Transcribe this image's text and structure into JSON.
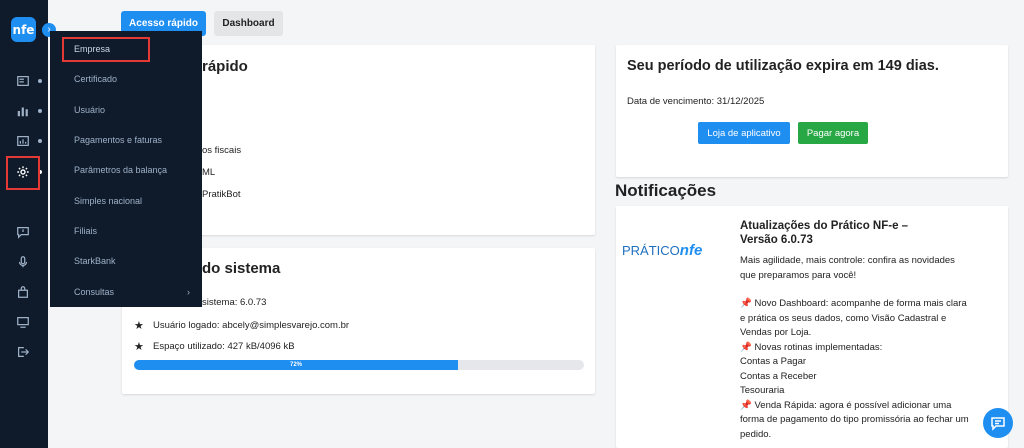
{
  "rail": {
    "logo_text": "nfe",
    "icons": [
      "dashboard-icon",
      "bar-chart-icon",
      "report-icon",
      "gear-icon",
      "message-icon",
      "microphone-icon",
      "bag-icon",
      "monitor-icon",
      "logout-icon"
    ]
  },
  "menu": {
    "items": [
      {
        "label": "Empresa"
      },
      {
        "label": "Certificado"
      },
      {
        "label": "Usuário"
      },
      {
        "label": "Pagamentos e faturas"
      },
      {
        "label": "Parâmetros da balança"
      },
      {
        "label": "Simples nacional"
      },
      {
        "label": "Filiais"
      },
      {
        "label": "StarkBank"
      },
      {
        "label": "Consultas"
      }
    ],
    "submenu_chevron": "›"
  },
  "tabs": {
    "quick_access": "Acesso rápido",
    "dashboard": "Dashboard"
  },
  "quick_card": {
    "title_visible": "rápido",
    "items_visible": [
      "os fiscais",
      "ML",
      "PratikBot"
    ]
  },
  "system_card": {
    "title_visible": "do sistema",
    "version_visible": "sistema: 6.0.73",
    "logged_user": "Usuário logado: abcely@simplesvarejo.com.br",
    "space_used": "Espaço utilizado: 427 kB/4096 kB",
    "progress_label": "72%",
    "progress_value": 72
  },
  "expiry_card": {
    "title": "Seu período de utilização expira em 149 dias.",
    "due_date": "Data de vencimento: 31/12/2025",
    "store_button": "Loja de aplicativo",
    "pay_button": "Pagar agora"
  },
  "notifications": {
    "heading": "Notificações",
    "logo_text": "PRÁTICO",
    "logo_mark": "nfe",
    "title": "Atualizações do Prático NF-e – Versão 6.0.73",
    "body": [
      "Mais agilidade, mais controle: confira as novidades que preparamos para você!",
      "",
      "📌 Novo Dashboard: acompanhe de forma mais clara e prática os seus dados, como Visão Cadastral e Vendas por Loja.",
      "📌 Novas rotinas implementadas:",
      "Contas a Pagar",
      "Contas a Receber",
      "Tesouraria",
      "📌 Venda Rápida: agora é possível adicionar uma forma de pagamento do tipo promissória ao fechar um pedido."
    ]
  },
  "colors": {
    "primary": "#1f8ef1",
    "success": "#28a745",
    "sidebar": "#0f1b2b",
    "highlight": "#e53935"
  }
}
